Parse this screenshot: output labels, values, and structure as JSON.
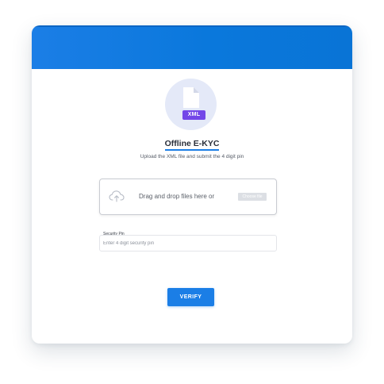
{
  "colors": {
    "header": "#1b7ee6",
    "accent": "#1b7ee6",
    "xml_tag": "#7347e8",
    "badge_circle": "#e4e9f8"
  },
  "icon": {
    "file_icon": "xml-file-icon",
    "tag_label": "XML",
    "upload_icon": "cloud-upload-icon"
  },
  "heading": {
    "title": "Offline E-KYC",
    "subtitle": "Upload the XML file and submit the 4 digit pin"
  },
  "upload": {
    "prompt": "Drag and drop files here or",
    "choose_label": "Choose file"
  },
  "security_pin": {
    "label": "Security Pin",
    "placeholder": "Enter 4 digit security pin",
    "value": ""
  },
  "actions": {
    "verify_label": "VERIFY"
  }
}
